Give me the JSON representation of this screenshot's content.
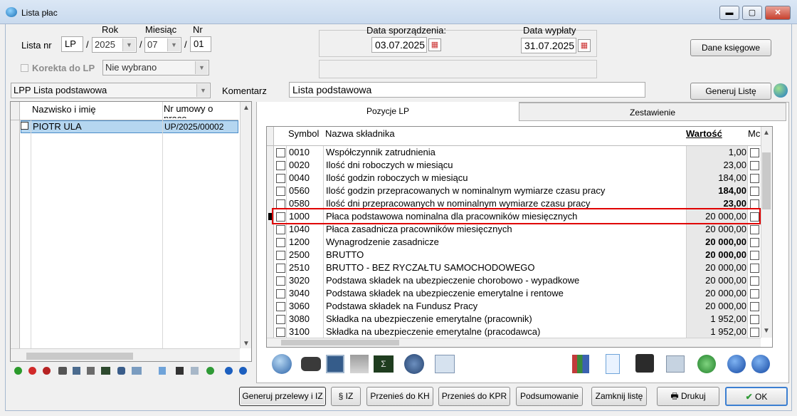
{
  "window": {
    "title": "Lista płac",
    "min": "▬",
    "max": "▢",
    "close": "✕"
  },
  "header": {
    "lista_nr_label": "Lista nr",
    "rok_label": "Rok",
    "miesiac_label": "Miesiąc",
    "nr_label": "Nr",
    "prefix": "LP",
    "rok": "2025",
    "miesiac": "07",
    "nr": "01",
    "sep": "/",
    "korekta_label": "Korekta  do LP",
    "korekta_value": "Nie wybrano",
    "data_sporzadzenia_label": "Data sporządzenia:",
    "data_sporzadzenia": "03.07.2025",
    "data_wyplaty_label": "Data wypłaty",
    "data_wyplaty": "31.07.2025",
    "dane_ksiegowe": "Dane księgowe",
    "lista_typ": "LPP Lista podstawowa",
    "komentarz_label": "Komentarz",
    "komentarz": "Lista podstawowa",
    "generuj_liste": "Generuj Listę"
  },
  "employees": {
    "col_name": "Nazwisko i imię",
    "col_umowa": "Nr umowy o praco",
    "rows": [
      {
        "name": "PIOTR ULA",
        "umowa": "UP/2025/00002"
      }
    ]
  },
  "tabs": {
    "pozycje": "Pozycje LP",
    "zestawienie": "Zestawienie"
  },
  "components": {
    "col_symbol": "Symbol",
    "col_nazwa": "Nazwa składnika",
    "col_wartosc": "Wartość",
    "col_mc": "Mc",
    "rows": [
      {
        "symbol": "0010",
        "nazwa": "Współczynnik zatrudnienia",
        "wartosc": "1,00",
        "bold": false
      },
      {
        "symbol": "0020",
        "nazwa": "Ilość dni roboczych w miesiącu",
        "wartosc": "23,00",
        "bold": false
      },
      {
        "symbol": "0040",
        "nazwa": "Ilość godzin roboczych w miesiącu",
        "wartosc": "184,00",
        "bold": false
      },
      {
        "symbol": "0560",
        "nazwa": "Ilość godzin przepracowanych w nominalnym wymiarze czasu pracy",
        "wartosc": "184,00",
        "bold": true
      },
      {
        "symbol": "0580",
        "nazwa": "Ilość dni przepracowanych w nominalnym wymiarze czasu pracy",
        "wartosc": "23,00",
        "bold": true
      },
      {
        "symbol": "1000",
        "nazwa": "Płaca podstawowa nominalna dla pracowników miesięcznych",
        "wartosc": "20 000,00",
        "bold": false
      },
      {
        "symbol": "1040",
        "nazwa": "Płaca zasadnicza pracowników miesięcznych",
        "wartosc": "20 000,00",
        "bold": false
      },
      {
        "symbol": "1200",
        "nazwa": "Wynagrodzenie zasadnicze",
        "wartosc": "20 000,00",
        "bold": true
      },
      {
        "symbol": "2500",
        "nazwa": "BRUTTO",
        "wartosc": "20 000,00",
        "bold": true
      },
      {
        "symbol": "2510",
        "nazwa": "BRUTTO - BEZ RYCZAŁTU SAMOCHODOWEGO",
        "wartosc": "20 000,00",
        "bold": false
      },
      {
        "symbol": "3020",
        "nazwa": "Podstawa składek na ubezpieczenie chorobowo - wypadkowe",
        "wartosc": "20 000,00",
        "bold": false
      },
      {
        "symbol": "3040",
        "nazwa": "Podstawa składek na ubezpieczenie emerytalne i rentowe",
        "wartosc": "20 000,00",
        "bold": false
      },
      {
        "symbol": "3060",
        "nazwa": "Podstawa składek na Fundusz Pracy",
        "wartosc": "20 000,00",
        "bold": false
      },
      {
        "symbol": "3080",
        "nazwa": "Składka na ubezpieczenie emerytalne (pracownik)",
        "wartosc": "1 952,00",
        "bold": false
      },
      {
        "symbol": "3100",
        "nazwa": "Składka na ubezpieczenie emerytalne (pracodawca)",
        "wartosc": "1 952,00",
        "bold": false
      }
    ]
  },
  "footer": {
    "generuj_przelewy": "Generuj przelewy i IZ",
    "iz": "IZ",
    "przenies_kh": "Przenieś do KH",
    "przenies_kpr": "Przenieś do KPR",
    "podsumowanie": "Podsumowanie",
    "zamknij": "Zamknij listę",
    "drukuj": "Drukuj",
    "ok": "OK"
  },
  "colors": {
    "highlight": "#e00000",
    "selected_row": "#b5d6f0",
    "accent": "#1a6fb5"
  }
}
